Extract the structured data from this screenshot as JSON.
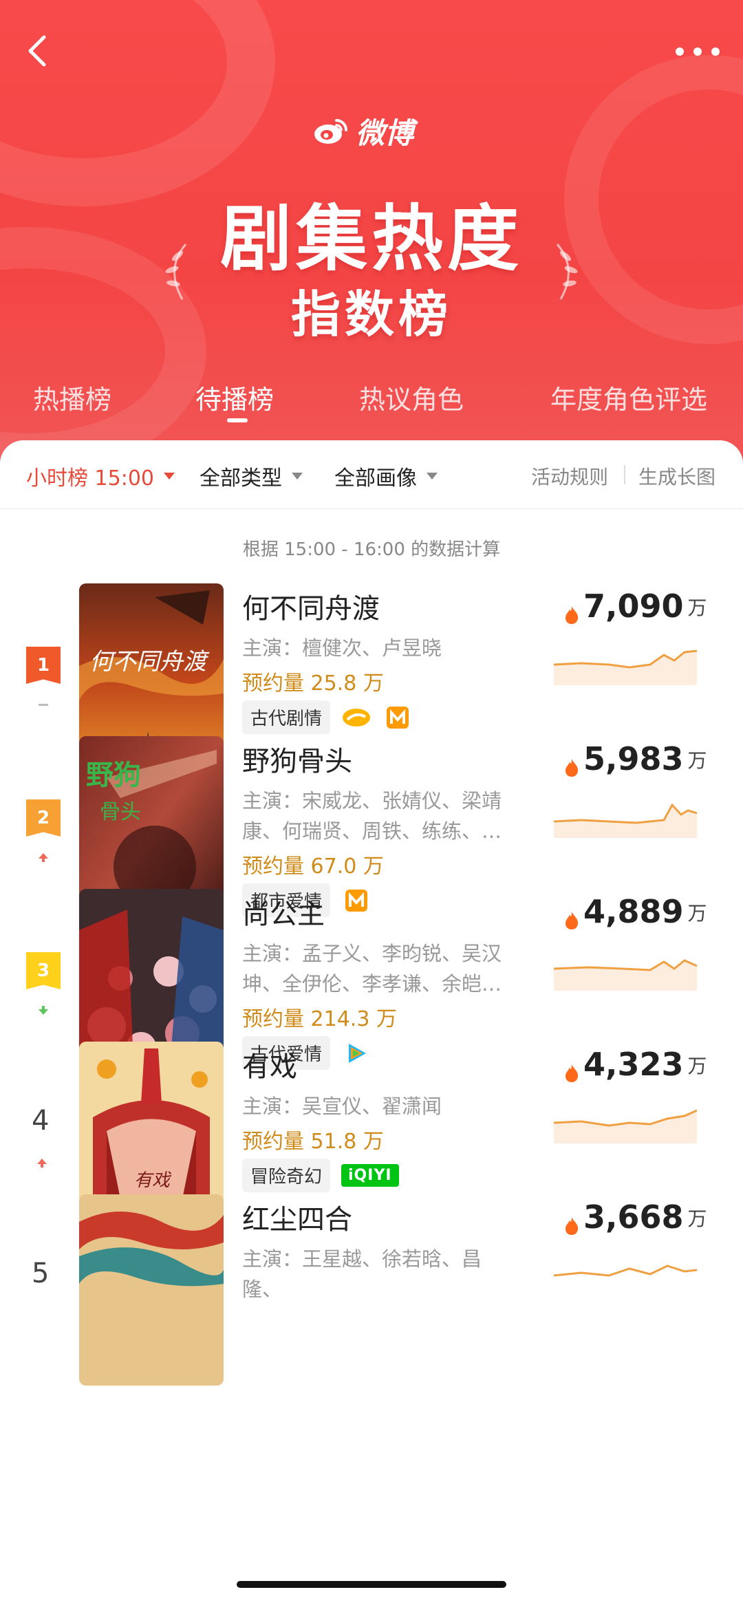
{
  "header": {
    "logo_text": "微博",
    "title_line1": "剧集热度",
    "title_line2": "指数榜",
    "tabs": [
      {
        "label": "热播榜"
      },
      {
        "label": "待播榜"
      },
      {
        "label": "热议角色"
      },
      {
        "label": "年度角色评选"
      }
    ],
    "active_tab": "待播榜"
  },
  "filters": {
    "hour": "小时榜 15:00",
    "type": "全部类型",
    "image": "全部画像",
    "rules": "活动规则",
    "gen_image": "生成长图"
  },
  "calc_note": "根据 15:00 - 16:00 的数据计算",
  "colors": {
    "brand_red": "#f44545",
    "accent_orange": "#d08b1a",
    "rank1": "#f05a2a",
    "rank2": "#f7a135",
    "rank3": "#ffd11a",
    "trend_up": "#f06a5a",
    "trend_down": "#5cc85c"
  },
  "items": [
    {
      "rank": "1",
      "title": "何不同舟渡",
      "cast": "主演：檀健次、卢昱晓",
      "reserve": "预约量 25.8 万",
      "genre": "古代剧情",
      "platforms": [
        "mango-tv-icon",
        "mgtv-icon"
      ],
      "heat": "7,090",
      "unit": "万",
      "trend": "flat"
    },
    {
      "rank": "2",
      "title": "野狗骨头",
      "cast": "主演：宋威龙、张婧仪、梁靖康、何瑞贤、周铁、练练、…",
      "reserve": "预约量 67.0 万",
      "genre": "都市爱情",
      "platforms": [
        "mgtv-icon"
      ],
      "heat": "5,983",
      "unit": "万",
      "trend": "up"
    },
    {
      "rank": "3",
      "title": "尚公主",
      "cast": "主演：孟子义、李昀锐、吴汉坤、全伊伦、李孝谦、余皑…",
      "reserve": "预约量 214.3 万",
      "genre": "古代爱情",
      "platforms": [
        "tencent-video-icon"
      ],
      "heat": "4,889",
      "unit": "万",
      "trend": "down"
    },
    {
      "rank": "4",
      "title": "有戏",
      "cast": "主演：吴宣仪、翟潇闻",
      "reserve": "预约量 51.8 万",
      "genre": "冒险奇幻",
      "platforms": [
        "iqiyi-icon"
      ],
      "platform_text": "iQIYI",
      "heat": "4,323",
      "unit": "万",
      "trend": "up"
    },
    {
      "rank": "5",
      "title": "红尘四合",
      "cast": "主演：王星越、徐若晗、昌隆、",
      "heat": "3,668",
      "unit": "万"
    }
  ]
}
